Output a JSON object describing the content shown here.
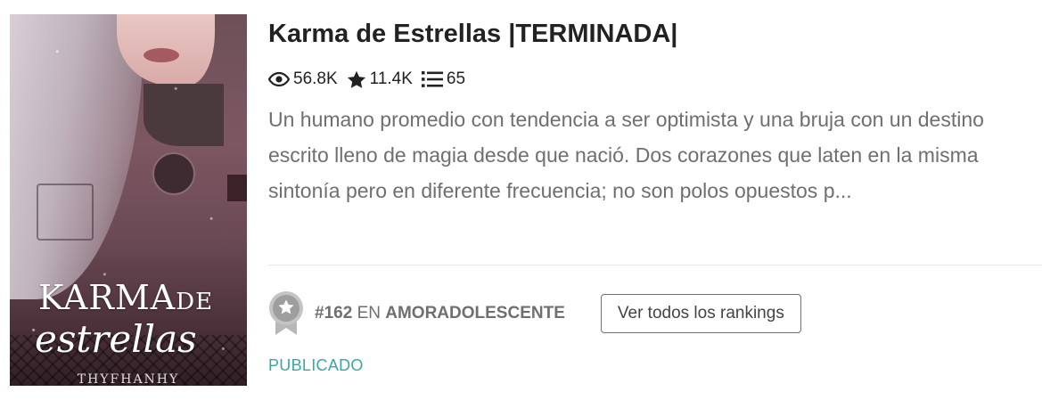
{
  "story": {
    "title": "Karma de Estrellas |TERMINADA|",
    "cover": {
      "title_line1": "KARMA",
      "title_de": "DE",
      "title_line2": "estrellas",
      "author": "THYFHANHY"
    },
    "stats": {
      "reads": "56.8K",
      "votes": "11.4K",
      "parts": "65",
      "reads_icon": "eye-icon",
      "votes_icon": "star-icon",
      "parts_icon": "list-icon"
    },
    "description": "Un humano promedio con tendencia a ser optimista y una bruja con un destino escrito lleno de magia desde que nació. Dos corazones que laten en la misma sintonía pero en diferente frecuencia; no son polos opuestos p...",
    "ranking": {
      "number": "#162",
      "preposition": "EN",
      "category": "AMORADOLESCENTE",
      "button_label": "Ver todos los rankings",
      "icon": "ribbon-medal-icon"
    },
    "status": "PUBLICADO"
  },
  "colors": {
    "accent_teal": "#3aa6a6",
    "text_dark": "#222222",
    "text_muted": "#6f6f6f",
    "divider": "#e6e6e6"
  }
}
